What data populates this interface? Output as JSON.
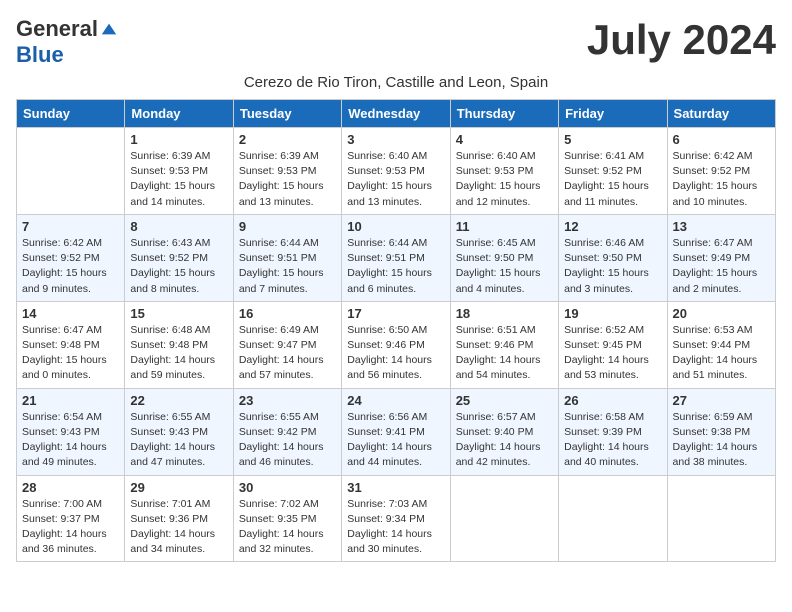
{
  "logo": {
    "general": "General",
    "blue": "Blue"
  },
  "header": {
    "month": "July 2024",
    "subtitle": "Cerezo de Rio Tiron, Castille and Leon, Spain"
  },
  "days": [
    "Sunday",
    "Monday",
    "Tuesday",
    "Wednesday",
    "Thursday",
    "Friday",
    "Saturday"
  ],
  "weeks": [
    [
      {
        "day": "",
        "sunrise": "",
        "sunset": "",
        "daylight": "",
        "empty": true
      },
      {
        "day": "1",
        "sunrise": "Sunrise: 6:39 AM",
        "sunset": "Sunset: 9:53 PM",
        "daylight": "Daylight: 15 hours and 14 minutes."
      },
      {
        "day": "2",
        "sunrise": "Sunrise: 6:39 AM",
        "sunset": "Sunset: 9:53 PM",
        "daylight": "Daylight: 15 hours and 13 minutes."
      },
      {
        "day": "3",
        "sunrise": "Sunrise: 6:40 AM",
        "sunset": "Sunset: 9:53 PM",
        "daylight": "Daylight: 15 hours and 13 minutes."
      },
      {
        "day": "4",
        "sunrise": "Sunrise: 6:40 AM",
        "sunset": "Sunset: 9:53 PM",
        "daylight": "Daylight: 15 hours and 12 minutes."
      },
      {
        "day": "5",
        "sunrise": "Sunrise: 6:41 AM",
        "sunset": "Sunset: 9:52 PM",
        "daylight": "Daylight: 15 hours and 11 minutes."
      },
      {
        "day": "6",
        "sunrise": "Sunrise: 6:42 AM",
        "sunset": "Sunset: 9:52 PM",
        "daylight": "Daylight: 15 hours and 10 minutes."
      }
    ],
    [
      {
        "day": "7",
        "sunrise": "Sunrise: 6:42 AM",
        "sunset": "Sunset: 9:52 PM",
        "daylight": "Daylight: 15 hours and 9 minutes."
      },
      {
        "day": "8",
        "sunrise": "Sunrise: 6:43 AM",
        "sunset": "Sunset: 9:52 PM",
        "daylight": "Daylight: 15 hours and 8 minutes."
      },
      {
        "day": "9",
        "sunrise": "Sunrise: 6:44 AM",
        "sunset": "Sunset: 9:51 PM",
        "daylight": "Daylight: 15 hours and 7 minutes."
      },
      {
        "day": "10",
        "sunrise": "Sunrise: 6:44 AM",
        "sunset": "Sunset: 9:51 PM",
        "daylight": "Daylight: 15 hours and 6 minutes."
      },
      {
        "day": "11",
        "sunrise": "Sunrise: 6:45 AM",
        "sunset": "Sunset: 9:50 PM",
        "daylight": "Daylight: 15 hours and 4 minutes."
      },
      {
        "day": "12",
        "sunrise": "Sunrise: 6:46 AM",
        "sunset": "Sunset: 9:50 PM",
        "daylight": "Daylight: 15 hours and 3 minutes."
      },
      {
        "day": "13",
        "sunrise": "Sunrise: 6:47 AM",
        "sunset": "Sunset: 9:49 PM",
        "daylight": "Daylight: 15 hours and 2 minutes."
      }
    ],
    [
      {
        "day": "14",
        "sunrise": "Sunrise: 6:47 AM",
        "sunset": "Sunset: 9:48 PM",
        "daylight": "Daylight: 15 hours and 0 minutes."
      },
      {
        "day": "15",
        "sunrise": "Sunrise: 6:48 AM",
        "sunset": "Sunset: 9:48 PM",
        "daylight": "Daylight: 14 hours and 59 minutes."
      },
      {
        "day": "16",
        "sunrise": "Sunrise: 6:49 AM",
        "sunset": "Sunset: 9:47 PM",
        "daylight": "Daylight: 14 hours and 57 minutes."
      },
      {
        "day": "17",
        "sunrise": "Sunrise: 6:50 AM",
        "sunset": "Sunset: 9:46 PM",
        "daylight": "Daylight: 14 hours and 56 minutes."
      },
      {
        "day": "18",
        "sunrise": "Sunrise: 6:51 AM",
        "sunset": "Sunset: 9:46 PM",
        "daylight": "Daylight: 14 hours and 54 minutes."
      },
      {
        "day": "19",
        "sunrise": "Sunrise: 6:52 AM",
        "sunset": "Sunset: 9:45 PM",
        "daylight": "Daylight: 14 hours and 53 minutes."
      },
      {
        "day": "20",
        "sunrise": "Sunrise: 6:53 AM",
        "sunset": "Sunset: 9:44 PM",
        "daylight": "Daylight: 14 hours and 51 minutes."
      }
    ],
    [
      {
        "day": "21",
        "sunrise": "Sunrise: 6:54 AM",
        "sunset": "Sunset: 9:43 PM",
        "daylight": "Daylight: 14 hours and 49 minutes."
      },
      {
        "day": "22",
        "sunrise": "Sunrise: 6:55 AM",
        "sunset": "Sunset: 9:43 PM",
        "daylight": "Daylight: 14 hours and 47 minutes."
      },
      {
        "day": "23",
        "sunrise": "Sunrise: 6:55 AM",
        "sunset": "Sunset: 9:42 PM",
        "daylight": "Daylight: 14 hours and 46 minutes."
      },
      {
        "day": "24",
        "sunrise": "Sunrise: 6:56 AM",
        "sunset": "Sunset: 9:41 PM",
        "daylight": "Daylight: 14 hours and 44 minutes."
      },
      {
        "day": "25",
        "sunrise": "Sunrise: 6:57 AM",
        "sunset": "Sunset: 9:40 PM",
        "daylight": "Daylight: 14 hours and 42 minutes."
      },
      {
        "day": "26",
        "sunrise": "Sunrise: 6:58 AM",
        "sunset": "Sunset: 9:39 PM",
        "daylight": "Daylight: 14 hours and 40 minutes."
      },
      {
        "day": "27",
        "sunrise": "Sunrise: 6:59 AM",
        "sunset": "Sunset: 9:38 PM",
        "daylight": "Daylight: 14 hours and 38 minutes."
      }
    ],
    [
      {
        "day": "28",
        "sunrise": "Sunrise: 7:00 AM",
        "sunset": "Sunset: 9:37 PM",
        "daylight": "Daylight: 14 hours and 36 minutes."
      },
      {
        "day": "29",
        "sunrise": "Sunrise: 7:01 AM",
        "sunset": "Sunset: 9:36 PM",
        "daylight": "Daylight: 14 hours and 34 minutes."
      },
      {
        "day": "30",
        "sunrise": "Sunrise: 7:02 AM",
        "sunset": "Sunset: 9:35 PM",
        "daylight": "Daylight: 14 hours and 32 minutes."
      },
      {
        "day": "31",
        "sunrise": "Sunrise: 7:03 AM",
        "sunset": "Sunset: 9:34 PM",
        "daylight": "Daylight: 14 hours and 30 minutes."
      },
      {
        "day": "",
        "sunrise": "",
        "sunset": "",
        "daylight": "",
        "empty": true
      },
      {
        "day": "",
        "sunrise": "",
        "sunset": "",
        "daylight": "",
        "empty": true
      },
      {
        "day": "",
        "sunrise": "",
        "sunset": "",
        "daylight": "",
        "empty": true
      }
    ]
  ]
}
